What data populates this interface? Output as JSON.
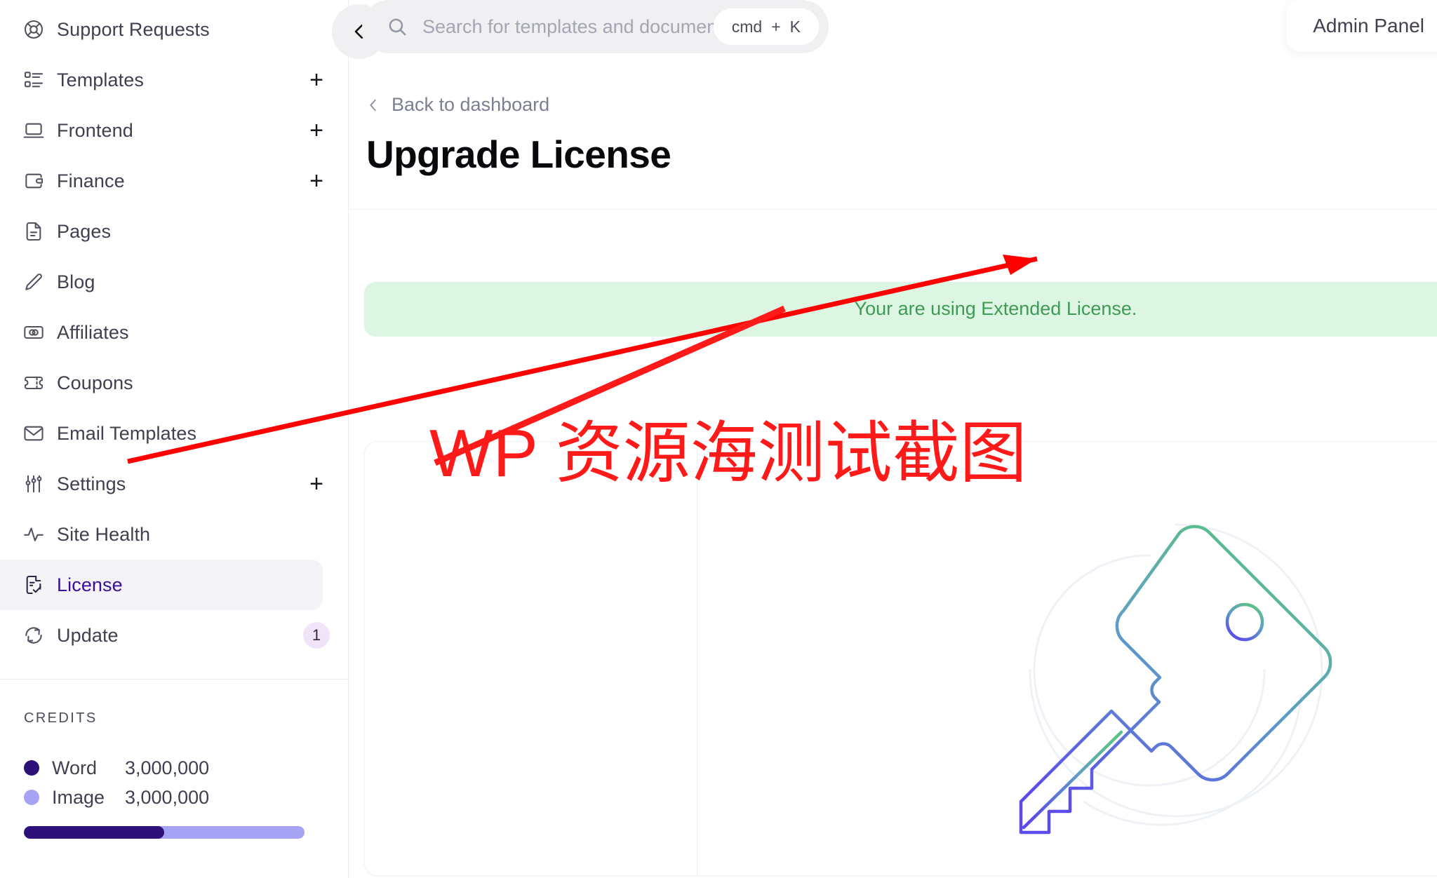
{
  "sidebar": {
    "items": [
      {
        "label": "Support Requests",
        "icon": "lifebuoy-icon",
        "plus": false,
        "badge": null,
        "active": false
      },
      {
        "label": "Templates",
        "icon": "list-box-icon",
        "plus": true,
        "badge": null,
        "active": false
      },
      {
        "label": "Frontend",
        "icon": "laptop-icon",
        "plus": true,
        "badge": null,
        "active": false
      },
      {
        "label": "Finance",
        "icon": "wallet-icon",
        "plus": true,
        "badge": null,
        "active": false
      },
      {
        "label": "Pages",
        "icon": "document-icon",
        "plus": false,
        "badge": null,
        "active": false
      },
      {
        "label": "Blog",
        "icon": "pencil-icon",
        "plus": false,
        "badge": null,
        "active": false
      },
      {
        "label": "Affiliates",
        "icon": "banknote-icon",
        "plus": false,
        "badge": null,
        "active": false
      },
      {
        "label": "Coupons",
        "icon": "ticket-icon",
        "plus": false,
        "badge": null,
        "active": false
      },
      {
        "label": "Email Templates",
        "icon": "envelope-icon",
        "plus": false,
        "badge": null,
        "active": false
      },
      {
        "label": "Settings",
        "icon": "sliders-icon",
        "plus": true,
        "badge": null,
        "active": false
      },
      {
        "label": "Site Health",
        "icon": "pulse-icon",
        "plus": false,
        "badge": null,
        "active": false
      },
      {
        "label": "License",
        "icon": "license-check-icon",
        "plus": false,
        "badge": null,
        "active": true
      },
      {
        "label": "Update",
        "icon": "refresh-icon",
        "plus": false,
        "badge": "1",
        "active": false
      }
    ],
    "credits": {
      "title": "CREDITS",
      "rows": [
        {
          "label": "Word",
          "value": "3,000,000",
          "color": "#2d1178"
        },
        {
          "label": "Image",
          "value": "3,000,000",
          "color": "#a5a3f4"
        }
      ],
      "bar": {
        "word_pct": 50,
        "word_color": "#2d1178",
        "image_color": "#a5a3f4"
      }
    }
  },
  "topbar": {
    "collapse_label": "Collapse sidebar",
    "search": {
      "placeholder": "Search for templates and documents...",
      "value": "",
      "shortcut_key": "cmd",
      "shortcut_plus": "+",
      "shortcut_letter": "K"
    },
    "admin_label": "Admin Panel"
  },
  "main": {
    "back_label": "Back to dashboard",
    "title": "Upgrade License",
    "alert": {
      "text": "Your are using Extended License.",
      "bg": "#ddf6e4",
      "fg": "#3f9a54"
    },
    "illustration": "key-icon"
  },
  "watermark": {
    "text": "WP 资源海测试截图",
    "color": "#ff1a1a",
    "strike_color": "#ff0000"
  }
}
